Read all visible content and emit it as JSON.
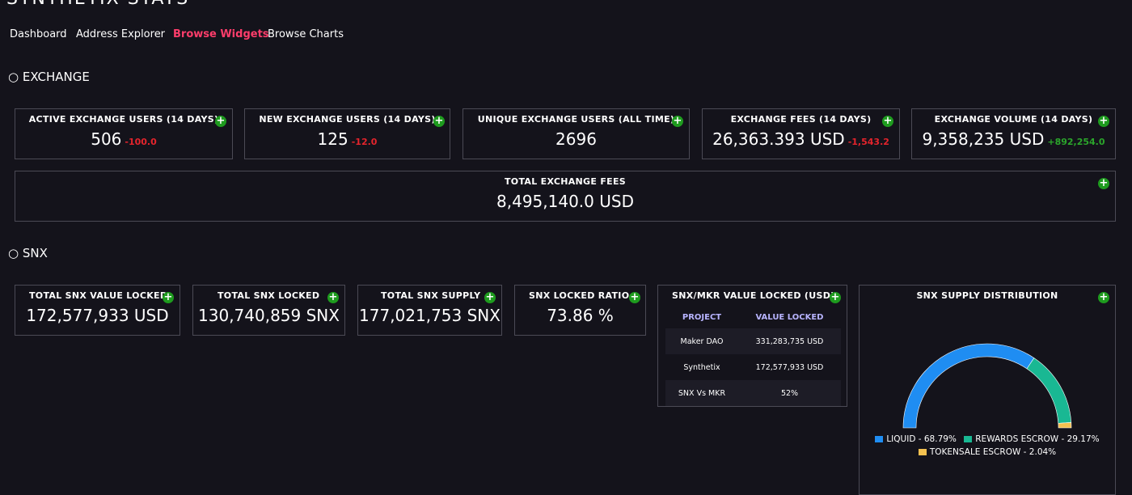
{
  "brand": "SYNTHETIX STATS",
  "nav": [
    {
      "label": "Dashboard",
      "active": false
    },
    {
      "label": "Address Explorer",
      "active": false
    },
    {
      "label": "Browse Widgets",
      "active": true
    },
    {
      "label": "Browse Charts",
      "active": false
    }
  ],
  "sections": {
    "exchange": "○ EXCHANGE",
    "snx": "○ SNX"
  },
  "exchange_cards": [
    {
      "title": "ACTIVE EXCHANGE USERS (14 DAYS)",
      "value": "506",
      "delta": "-100.0"
    },
    {
      "title": "NEW EXCHANGE USERS (14 DAYS)",
      "value": "125",
      "delta": "-12.0"
    },
    {
      "title": "UNIQUE EXCHANGE USERS (ALL TIME)",
      "value": "2696"
    },
    {
      "title": "EXCHANGE FEES (14 DAYS)",
      "value": "26,363.393 USD",
      "delta": "-1,543.2"
    },
    {
      "title": "EXCHANGE VOLUME (14 DAYS)",
      "value": "9,358,235 USD",
      "delta": "+892,254.0"
    }
  ],
  "total_fees": {
    "title": "TOTAL EXCHANGE FEES",
    "value": "8,495,140.0 USD"
  },
  "snx_cards": [
    {
      "title": "TOTAL SNX VALUE LOCKED",
      "value": "172,577,933 USD"
    },
    {
      "title": "TOTAL SNX LOCKED",
      "value": "130,740,859 SNX"
    },
    {
      "title": "TOTAL SNX SUPPLY",
      "value": "177,021,753 SNX"
    },
    {
      "title": "SNX LOCKED RATIO",
      "value": "73.86 %"
    }
  ],
  "mkr_table": {
    "title": "SNX/MKR VALUE LOCKED (USD)",
    "headers": [
      "PROJECT",
      "VALUE LOCKED"
    ],
    "rows": [
      [
        "Maker DAO",
        "331,283,735 USD"
      ],
      [
        "Synthetix",
        "172,577,933 USD"
      ],
      [
        "SNX Vs MKR",
        "52%"
      ]
    ]
  },
  "distribution": {
    "title": "SNX SUPPLY DISTRIBUTION",
    "legend": [
      {
        "label": "LIQUID - 68.79%",
        "color": "#1f8df2"
      },
      {
        "label": "REWARDS ESCROW - 29.17%",
        "color": "#19b893"
      },
      {
        "label": "TOKENSALE ESCROW - 2.04%",
        "color": "#f4c150"
      }
    ]
  },
  "chart_data": {
    "type": "pie",
    "title": "SNX SUPPLY DISTRIBUTION",
    "categories": [
      "LIQUID",
      "REWARDS ESCROW",
      "TOKENSALE ESCROW"
    ],
    "values": [
      68.79,
      29.17,
      2.04
    ],
    "colors": [
      "#1f8df2",
      "#19b893",
      "#f4c150"
    ],
    "legend": "bottom"
  },
  "icons": {
    "add": "plus-circle-icon"
  },
  "colors": {
    "accent": "#ff3d6b",
    "negative": "#e5242c",
    "positive": "#2ba52b",
    "add": "#1e9b1e"
  }
}
